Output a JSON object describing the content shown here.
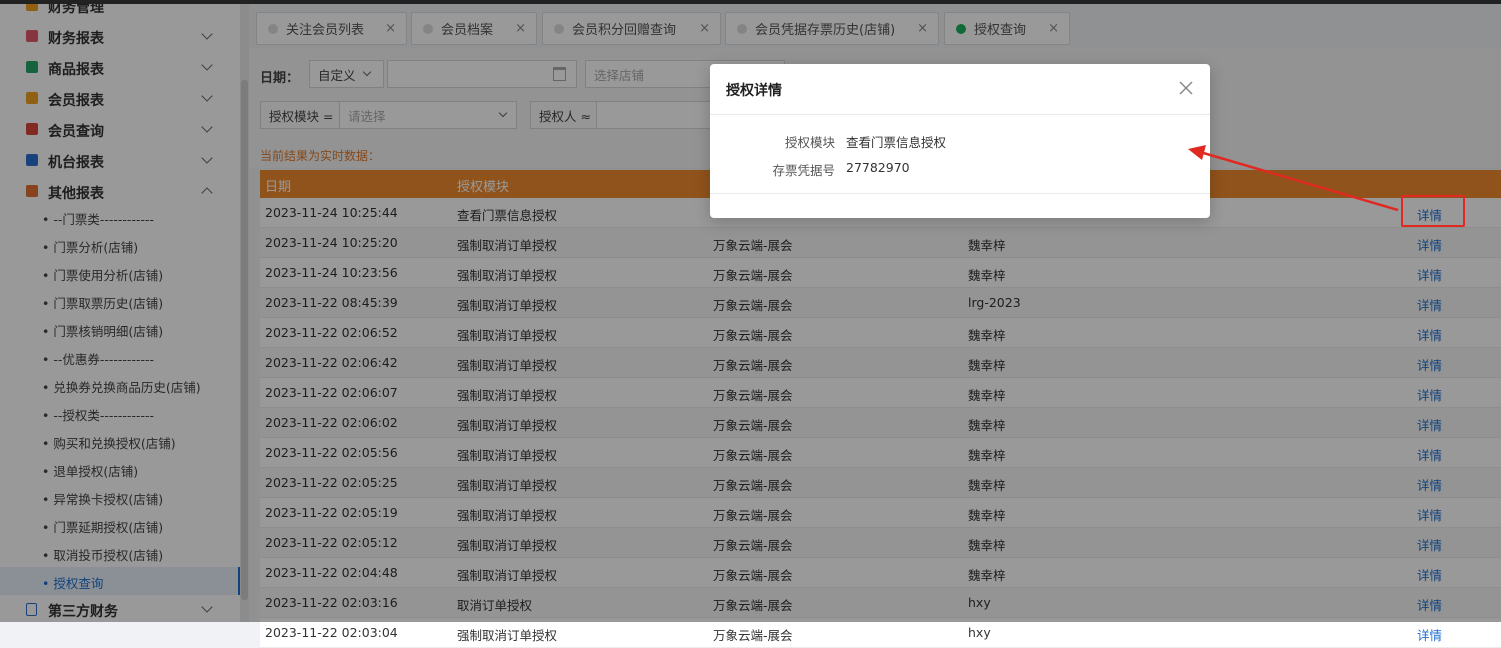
{
  "sidebar": {
    "cut_item": "财务管理",
    "groups": [
      {
        "label": "财务报表",
        "color": "#e05a6a"
      },
      {
        "label": "商品报表",
        "color": "#2aa36b"
      },
      {
        "label": "会员报表",
        "color": "#f0a020"
      },
      {
        "label": "会员查询",
        "color": "#d9453a"
      },
      {
        "label": "机台报表",
        "color": "#2f6fd0"
      },
      {
        "label": "其他报表",
        "color": "#e07030"
      }
    ],
    "sub_items": [
      "• --门票类------------",
      "• 门票分析(店铺)",
      "• 门票使用分析(店铺)",
      "• 门票取票历史(店铺)",
      "• 门票核销明细(店铺)",
      "• --优惠券------------",
      "• 兑换券兑换商品历史(店铺)",
      "• --授权类------------",
      "• 购买和兑换授权(店铺)",
      "• 退单授权(店铺)",
      "• 异常换卡授权(店铺)",
      "• 门票延期授权(店铺)",
      "• 取消投币授权(店铺)",
      "• 授权查询"
    ],
    "bottom_group": {
      "label": "第三方财务",
      "color": "#2f6fd0"
    }
  },
  "tabs": [
    {
      "label": "关注会员列表",
      "close": "×",
      "active": false
    },
    {
      "label": "会员档案",
      "close": "×",
      "active": false
    },
    {
      "label": "会员积分回赠查询",
      "close": "×",
      "active": false
    },
    {
      "label": "会员凭据存票历史(店铺)",
      "close": "×",
      "active": false
    },
    {
      "label": "授权查询",
      "close": "×",
      "active": true
    }
  ],
  "filter": {
    "date_label": "日期：",
    "date_mode": "自定义",
    "store_placeholder": "选择店铺",
    "module_label": "授权模块 =",
    "module_placeholder": "请选择",
    "person_label": "授权人 ≈"
  },
  "notice": "当前结果为实时数据：",
  "table": {
    "headers": [
      "日期",
      "授权模块"
    ],
    "detail_label": "详情",
    "rows": [
      {
        "date": "2023-11-24 10:25:44",
        "module": "查看门票信息授权",
        "store": "",
        "person": ""
      },
      {
        "date": "2023-11-24 10:25:20",
        "module": "强制取消订单授权",
        "store": "万象云端-展会",
        "person": "魏幸梓"
      },
      {
        "date": "2023-11-24 10:23:56",
        "module": "强制取消订单授权",
        "store": "万象云端-展会",
        "person": "魏幸梓"
      },
      {
        "date": "2023-11-22 08:45:39",
        "module": "强制取消订单授权",
        "store": "万象云端-展会",
        "person": "lrg-2023"
      },
      {
        "date": "2023-11-22 02:06:52",
        "module": "强制取消订单授权",
        "store": "万象云端-展会",
        "person": "魏幸梓"
      },
      {
        "date": "2023-11-22 02:06:42",
        "module": "强制取消订单授权",
        "store": "万象云端-展会",
        "person": "魏幸梓"
      },
      {
        "date": "2023-11-22 02:06:07",
        "module": "强制取消订单授权",
        "store": "万象云端-展会",
        "person": "魏幸梓"
      },
      {
        "date": "2023-11-22 02:06:02",
        "module": "强制取消订单授权",
        "store": "万象云端-展会",
        "person": "魏幸梓"
      },
      {
        "date": "2023-11-22 02:05:56",
        "module": "强制取消订单授权",
        "store": "万象云端-展会",
        "person": "魏幸梓"
      },
      {
        "date": "2023-11-22 02:05:25",
        "module": "强制取消订单授权",
        "store": "万象云端-展会",
        "person": "魏幸梓"
      },
      {
        "date": "2023-11-22 02:05:19",
        "module": "强制取消订单授权",
        "store": "万象云端-展会",
        "person": "魏幸梓"
      },
      {
        "date": "2023-11-22 02:05:12",
        "module": "强制取消订单授权",
        "store": "万象云端-展会",
        "person": "魏幸梓"
      },
      {
        "date": "2023-11-22 02:04:48",
        "module": "强制取消订单授权",
        "store": "万象云端-展会",
        "person": "魏幸梓"
      },
      {
        "date": "2023-11-22 02:03:16",
        "module": "取消订单授权",
        "store": "万象云端-展会",
        "person": "hxy"
      },
      {
        "date": "2023-11-22 02:03:04",
        "module": "强制取消订单授权",
        "store": "万象云端-展会",
        "person": "hxy"
      }
    ]
  },
  "modal": {
    "title": "授权详情",
    "fields": [
      {
        "key": "授权模块",
        "value": "查看门票信息授权"
      },
      {
        "key": "存票凭据号",
        "value": "27782970"
      }
    ]
  },
  "colors": {
    "accent": "#1e6fd0",
    "header": "#f08a2e",
    "annotation": "#e02a21",
    "active_tab_dot": "#1db15a"
  }
}
